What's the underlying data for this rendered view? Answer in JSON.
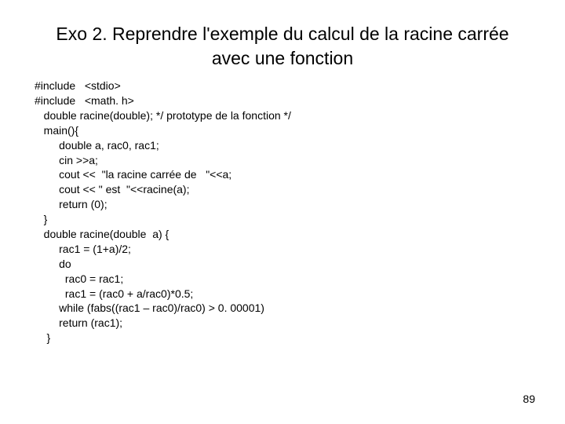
{
  "title_line1": "Exo 2. Reprendre l'exemple du calcul de la racine carrée",
  "title_line2": "avec une fonction",
  "code": "#include   <stdio>\n#include   <math. h>\n   double racine(double); */ prototype de la fonction */\n   main(){\n        double a, rac0, rac1;\n        cin >>a;\n        cout <<  \"la racine carrée de   \"<<a;\n        cout << \" est  \"<<racine(a);\n        return (0);\n   }\n   double racine(double  a) {\n        rac1 = (1+a)/2;\n        do\n          rac0 = rac1;\n          rac1 = (rac0 + a/rac0)*0.5;\n        while (fabs((rac1 – rac0)/rac0) > 0. 00001)\n        return (rac1);\n    }",
  "page_number": "89"
}
